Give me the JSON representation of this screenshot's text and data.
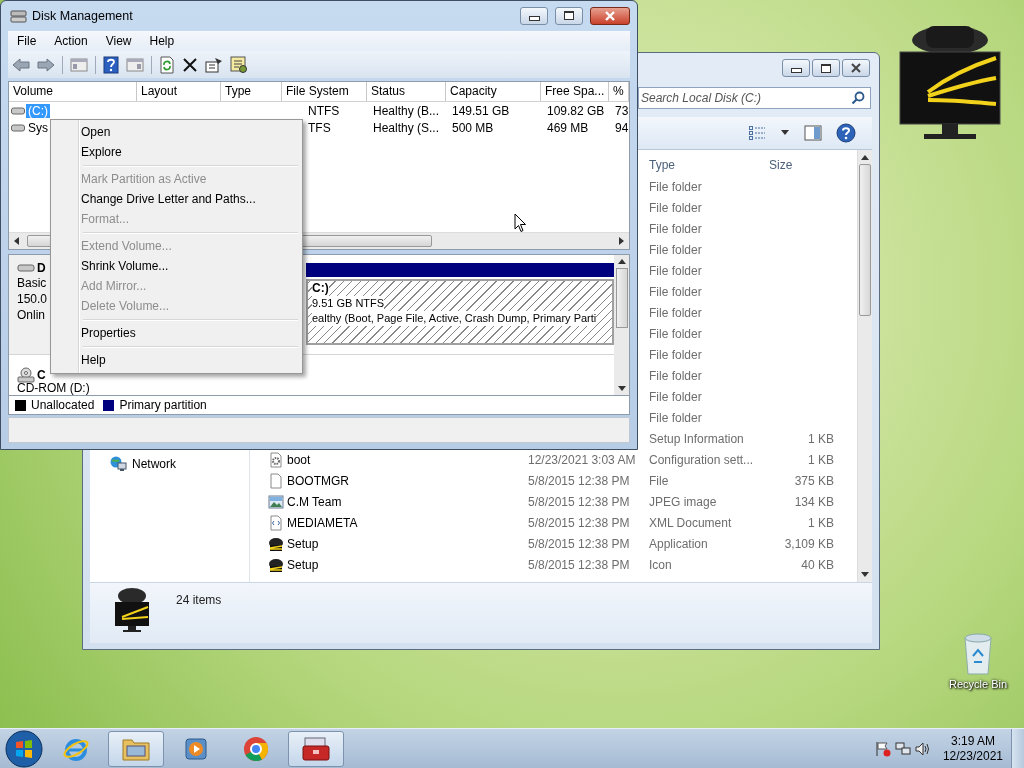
{
  "explorer_window": {
    "search": {
      "placeholder": "Search Local Disk (C:)"
    },
    "columns": [
      "Type",
      "Size"
    ],
    "nav_items": [
      {
        "label": "Network"
      }
    ],
    "rows": [
      {
        "type": "File folder"
      },
      {
        "type": "File folder"
      },
      {
        "type": "File folder"
      },
      {
        "type": "File folder"
      },
      {
        "type": "File folder"
      },
      {
        "type": "File folder"
      },
      {
        "type": "File folder"
      },
      {
        "type": "File folder"
      },
      {
        "type": "File folder"
      },
      {
        "type": "File folder"
      },
      {
        "type": "File folder"
      },
      {
        "type": "File folder"
      },
      {
        "type": "Setup Information",
        "size": "1 KB"
      },
      {
        "kind": "config",
        "name": "boot",
        "date": "12/23/2021 3:03 AM",
        "type": "Configuration sett...",
        "size": "1 KB"
      },
      {
        "kind": "file",
        "name": "BOOTMGR",
        "date": "5/8/2015 12:38 PM",
        "type": "File",
        "size": "375 KB"
      },
      {
        "kind": "image",
        "name": "C.M Team",
        "date": "5/8/2015 12:38 PM",
        "type": "JPEG image",
        "size": "134 KB"
      },
      {
        "kind": "xml",
        "name": "MEDIAMETA",
        "date": "5/8/2015 12:38 PM",
        "type": "XML Document",
        "size": "1 KB"
      },
      {
        "kind": "app",
        "name": "Setup",
        "date": "5/8/2015 12:38 PM",
        "type": "Application",
        "size": "3,109 KB"
      },
      {
        "kind": "app",
        "name": "Setup",
        "date": "5/8/2015 12:38 PM",
        "type": "Icon",
        "size": "40 KB"
      }
    ],
    "status": "24 items"
  },
  "disk_management": {
    "title": "Disk Management",
    "menu": [
      "File",
      "Action",
      "View",
      "Help"
    ],
    "columns": [
      "Volume",
      "Layout",
      "Type",
      "File System",
      "Status",
      "Capacity",
      "Free Spa...",
      "%"
    ],
    "volumes": [
      {
        "selected": true,
        "cells": [
          "(C:)",
          "",
          "",
          "NTFS",
          "Healthy (B...",
          "149.51 GB",
          "109.82 GB",
          "73"
        ]
      },
      {
        "selected": false,
        "cells": [
          "Sys",
          "",
          "",
          "TFS",
          "Healthy (S...",
          "500 MB",
          "469 MB",
          "94"
        ]
      }
    ],
    "disks": [
      {
        "kind": "disk",
        "name": "D",
        "lines": [
          "Basic",
          "150.0",
          "Onlin"
        ],
        "partition": {
          "name": "C:)",
          "size": "9.51 GB NTFS",
          "status": "ealthy (Boot, Page File, Active, Crash Dump, Primary Parti",
          "color": "#00007f"
        }
      },
      {
        "kind": "cdrom",
        "name": "C",
        "lines": [
          "CD-ROM (D:)"
        ]
      }
    ],
    "legend": [
      {
        "label": "Unallocated",
        "color": "#000000"
      },
      {
        "label": "Primary partition",
        "color": "#00007f"
      }
    ]
  },
  "context_menu": [
    {
      "kind": "item",
      "label": "Open",
      "disabled": false
    },
    {
      "kind": "item",
      "label": "Explore",
      "disabled": false
    },
    {
      "kind": "separator"
    },
    {
      "kind": "item",
      "label": "Mark Partition as Active",
      "disabled": true
    },
    {
      "kind": "item",
      "label": "Change Drive Letter and Paths...",
      "disabled": false
    },
    {
      "kind": "item",
      "label": "Format...",
      "disabled": true
    },
    {
      "kind": "separator"
    },
    {
      "kind": "item",
      "label": "Extend Volume...",
      "disabled": true
    },
    {
      "kind": "item",
      "label": "Shrink Volume...",
      "disabled": false
    },
    {
      "kind": "item",
      "label": "Add Mirror...",
      "disabled": true
    },
    {
      "kind": "item",
      "label": "Delete Volume...",
      "disabled": true
    },
    {
      "kind": "separator"
    },
    {
      "kind": "item",
      "label": "Properties",
      "disabled": false
    },
    {
      "kind": "separator"
    },
    {
      "kind": "item",
      "label": "Help",
      "disabled": false
    }
  ],
  "desktop": {
    "icons": [
      {
        "label": "Recycle Bin"
      }
    ]
  },
  "taskbar": {
    "apps": [
      {
        "kind": "ie",
        "active": false
      },
      {
        "kind": "explorer",
        "active": true
      },
      {
        "kind": "media",
        "active": false
      },
      {
        "kind": "chrome",
        "active": false
      },
      {
        "kind": "toolbox",
        "active": true
      }
    ],
    "time": "3:19 AM",
    "date": "12/23/2021"
  }
}
